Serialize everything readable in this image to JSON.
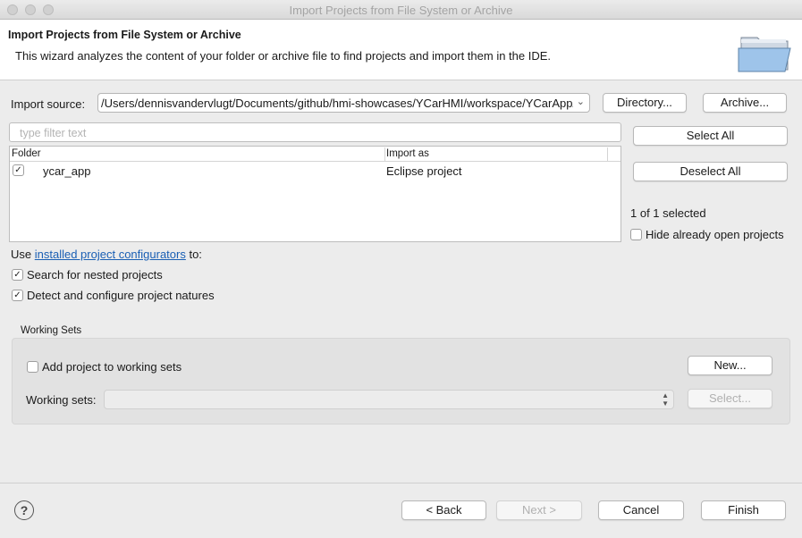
{
  "window": {
    "title": "Import Projects from File System or Archive"
  },
  "header": {
    "title": "Import Projects from File System or Archive",
    "description": "This wizard analyzes the content of your folder or archive file to find projects and import them in the IDE."
  },
  "source": {
    "label": "Import source:",
    "value": "/Users/dennisvandervlugt/Documents/github/hmi-showcases/YCarHMI/workspace/YCarApp/ycar_app",
    "directory_button": "Directory...",
    "archive_button": "Archive..."
  },
  "filter": {
    "placeholder": "type filter text"
  },
  "table": {
    "headers": [
      "Folder",
      "Import as"
    ],
    "rows": [
      {
        "checked": true,
        "folder": "ycar_app",
        "import_as": "Eclipse project"
      }
    ]
  },
  "side": {
    "select_all": "Select All",
    "deselect_all": "Deselect All",
    "count": "1 of 1 selected",
    "hide_open": "Hide already open projects"
  },
  "configurators": {
    "prefix": "Use",
    "link": "installed project configurators",
    "suffix": "to:"
  },
  "options": {
    "nested": "Search for nested projects",
    "natures": "Detect and configure project natures"
  },
  "working_sets": {
    "title": "Working Sets",
    "add_label": "Add project to working sets",
    "new_button": "New...",
    "sets_label": "Working sets:",
    "select_button": "Select..."
  },
  "footer": {
    "back": "< Back",
    "next": "Next >",
    "cancel": "Cancel",
    "finish": "Finish",
    "help": "?"
  },
  "icons": {
    "header": "folder-open-icon",
    "help": "help-icon",
    "check": "checkmark-icon"
  },
  "colors": {
    "link": "#1a5fb4",
    "header_bg": "#ffffff",
    "dialog_bg": "#ececec"
  }
}
